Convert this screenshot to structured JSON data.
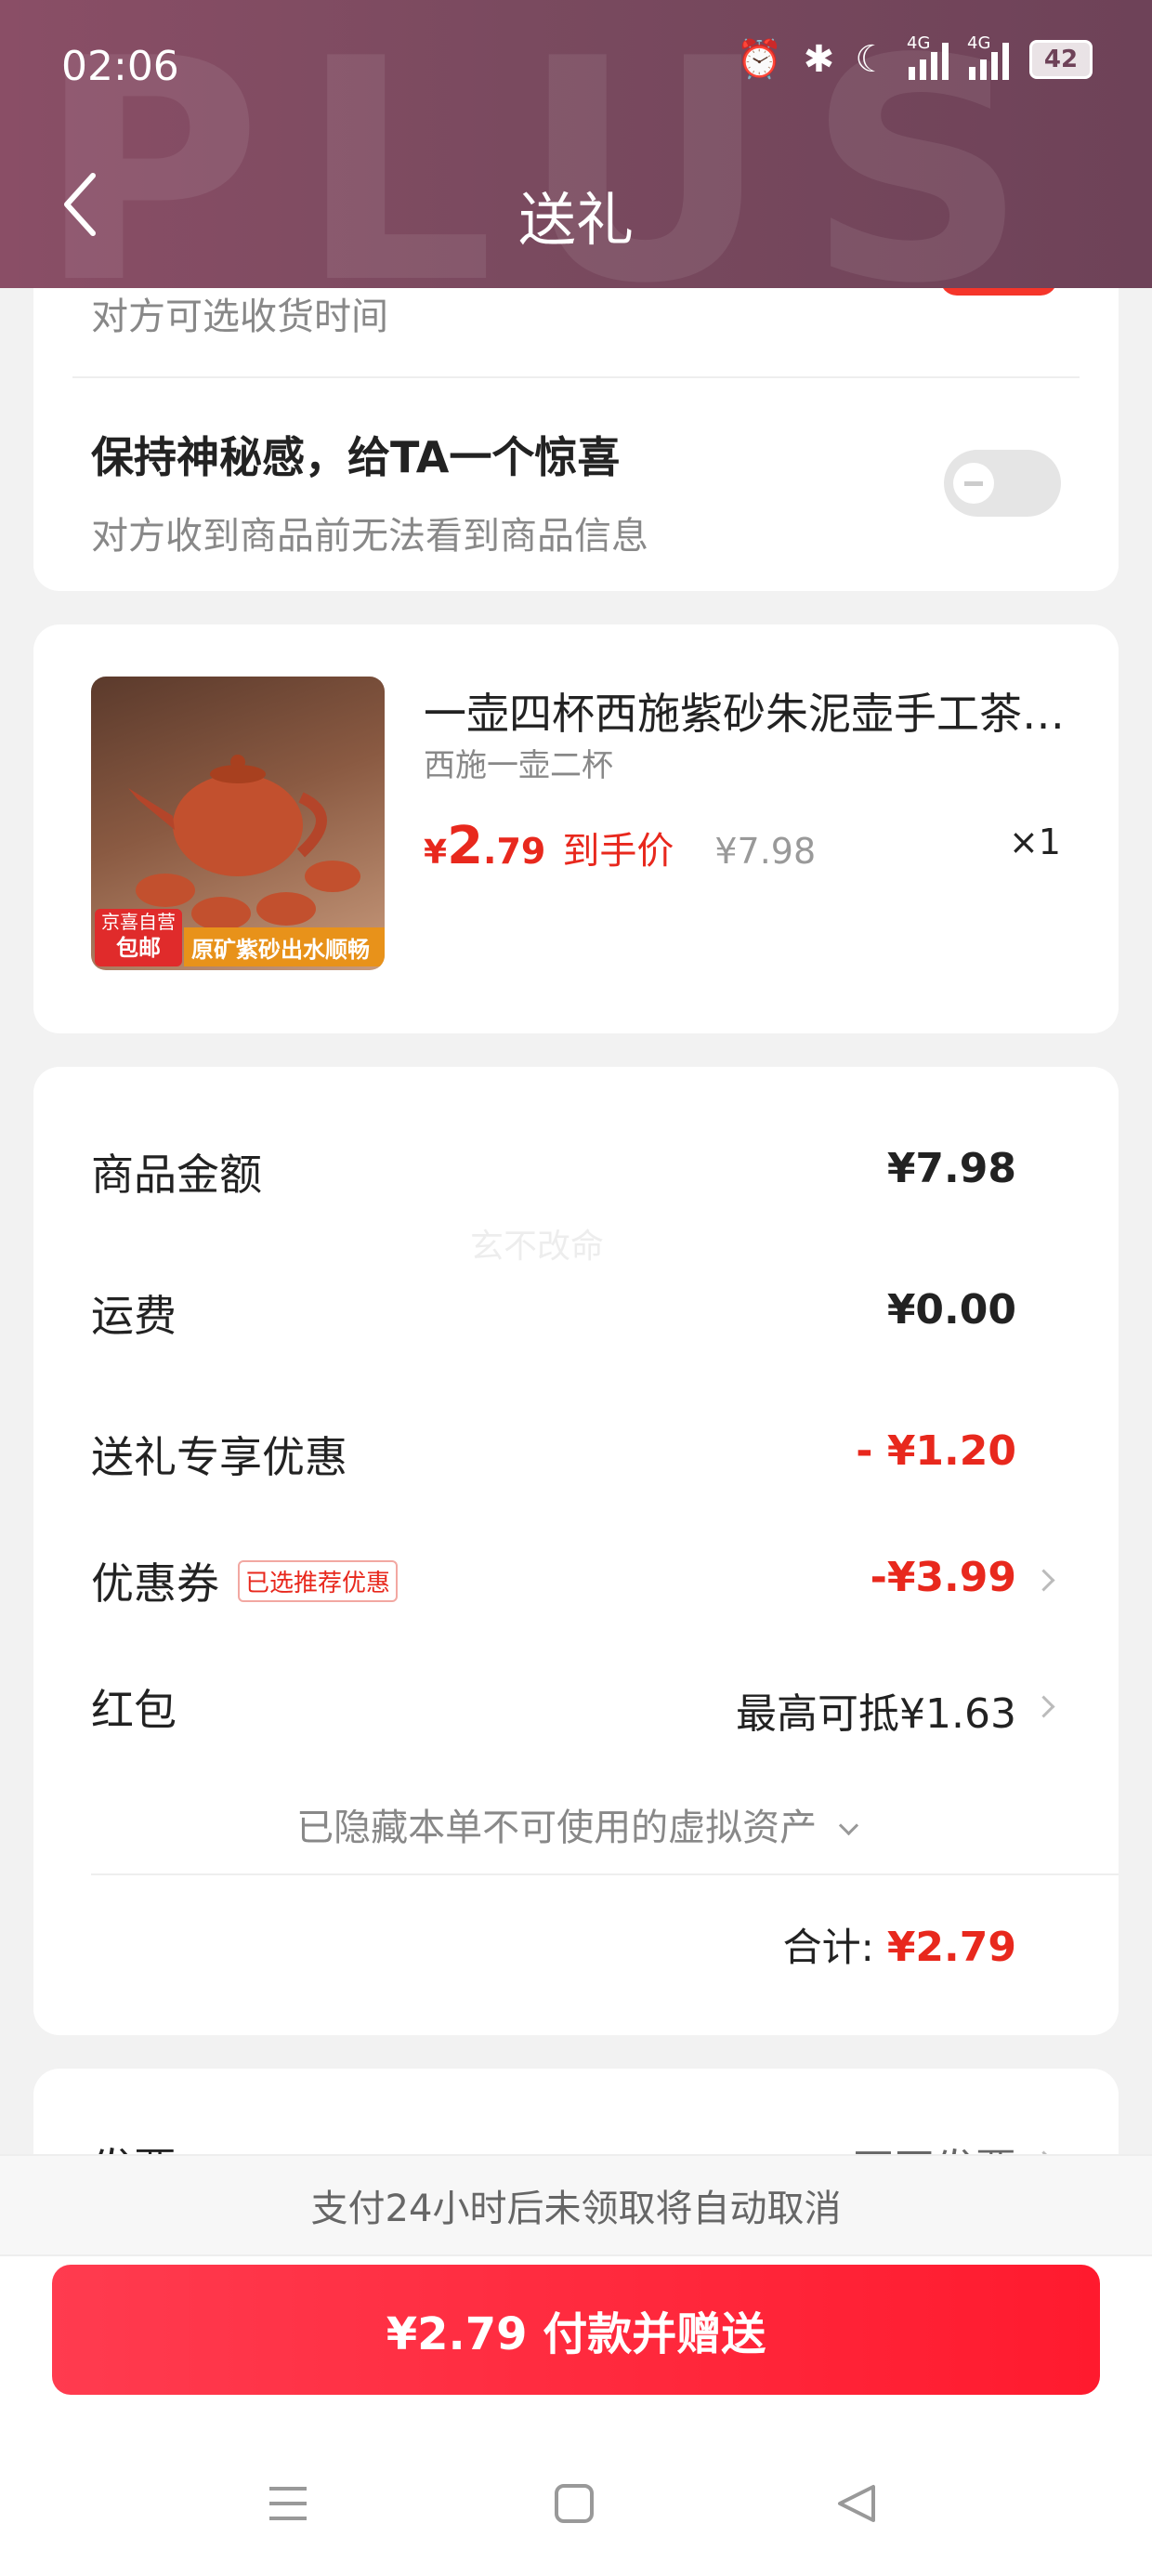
{
  "status_bar": {
    "time": "02:06",
    "battery": "42",
    "signal_labels": [
      "4G",
      "4G"
    ]
  },
  "header": {
    "title": "送礼",
    "watermark": "PLUS"
  },
  "options": {
    "delivery_time_sub": "对方可选收货时间",
    "mystery_title": "保持神秘感，给TA一个惊喜",
    "mystery_sub": "对方收到商品前无法看到商品信息",
    "mystery_enabled": false
  },
  "product": {
    "name": "一壶四杯西施紫砂朱泥壶手工茶…",
    "spec": "西施一壶二杯",
    "price_symbol": "¥",
    "price_int": "2",
    "price_dec": ".79",
    "price_tag": "到手价",
    "original_price": "¥7.98",
    "quantity": "×1",
    "image_badge_top": "京喜自营",
    "image_badge_bottom": "包邮",
    "image_banner": "原矿紫砂出水顺畅"
  },
  "summary": {
    "items": [
      {
        "label": "商品金额",
        "value": "¥7.98"
      },
      {
        "label": "运费",
        "value": "¥0.00"
      },
      {
        "label": "送礼专享优惠",
        "value": "- ¥1.20"
      },
      {
        "label": "优惠券",
        "tag": "已选推荐优惠",
        "value": "-¥3.99"
      },
      {
        "label": "红包",
        "value": "最高可抵¥1.63"
      }
    ],
    "hidden_assets": "已隐藏本单不可使用的虚拟资产",
    "total_label": "合计:",
    "total_value": "¥2.79",
    "watermark": "玄不改命"
  },
  "invoice": {
    "label": "发票",
    "value": "不开发票"
  },
  "footer": {
    "notice": "支付24小时后未领取将自动取消",
    "pay_button": "¥2.79 付款并赠送"
  },
  "colors": {
    "accent": "#e8281d",
    "header": "#7a4a5f",
    "button": "#ff1a2e"
  }
}
